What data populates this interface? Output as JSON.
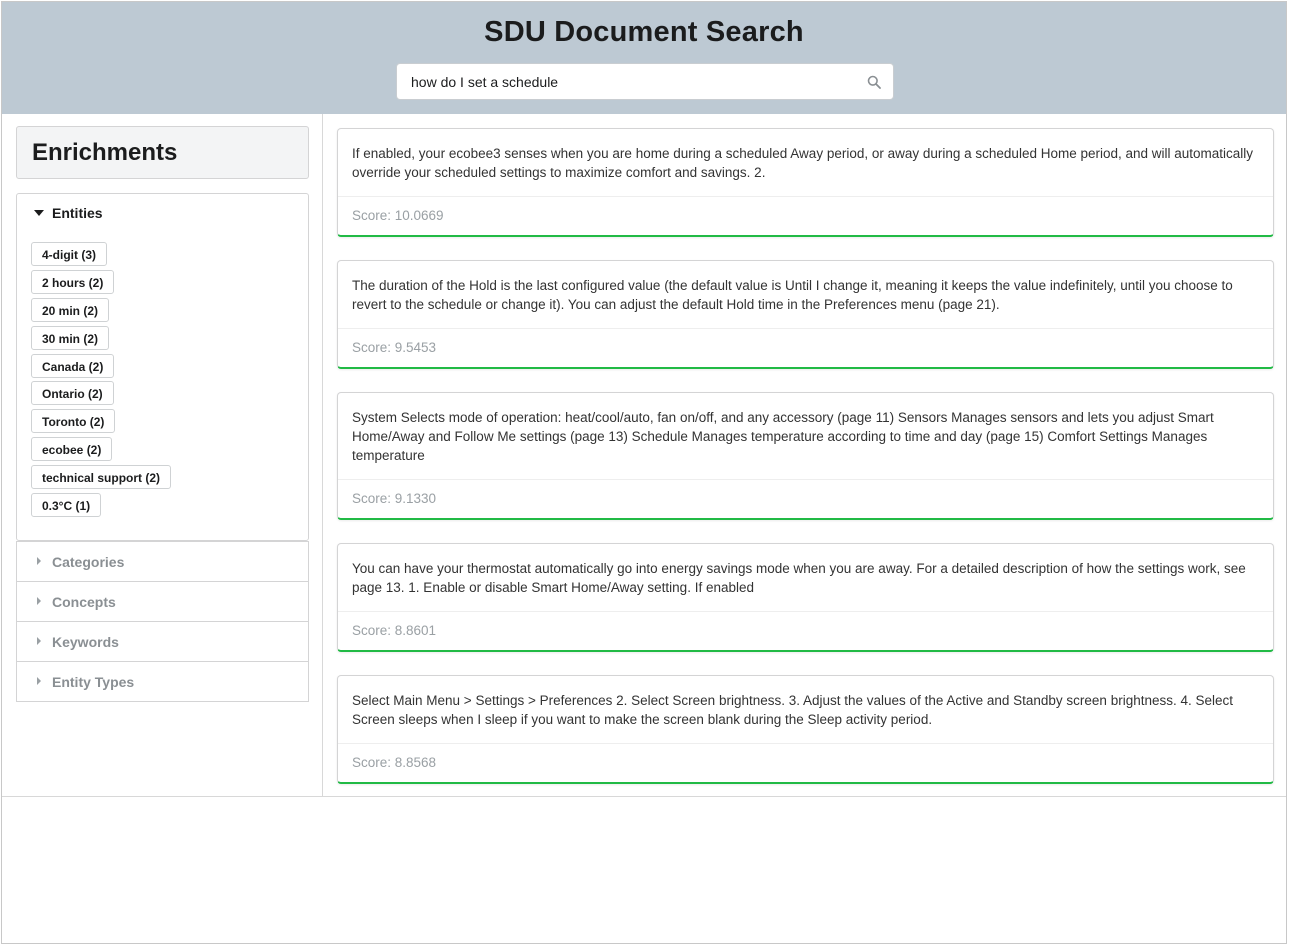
{
  "app": {
    "title": "SDU Document Search"
  },
  "search": {
    "value": "how do I set a schedule",
    "icon": "search-icon"
  },
  "sidebar": {
    "title": "Enrichments",
    "entities": {
      "label": "Entities",
      "expanded": true,
      "items": [
        "4-digit (3)",
        "2 hours (2)",
        "20 min (2)",
        "30 min (2)",
        "Canada (2)",
        "Ontario (2)",
        "Toronto (2)",
        "ecobee (2)",
        "technical support (2)",
        "0.3°C (1)"
      ]
    },
    "collapsed_panels": [
      {
        "label": "Categories"
      },
      {
        "label": "Concepts"
      },
      {
        "label": "Keywords"
      },
      {
        "label": "Entity Types"
      }
    ]
  },
  "results": [
    {
      "text": "If enabled, your ecobee3 senses when you are home during a scheduled Away period, or away during a scheduled Home period, and will automatically override your scheduled settings to maximize comfort and savings. 2.",
      "score": "Score: 10.0669"
    },
    {
      "text": "The duration of the Hold is the last configured value (the default value is Until I change it, meaning it keeps the value indefinitely, until you choose to revert to the schedule or change it). You can adjust the default Hold time in the Preferences menu (page 21).",
      "score": "Score: 9.5453"
    },
    {
      "text": "System Selects mode of operation: heat/cool/auto, fan on/off, and any accessory (page 11) Sensors Manages sensors and lets you adjust Smart Home/Away and Follow Me settings (page 13) Schedule Manages temperature according to time and day (page 15) Comfort Settings Manages temperature",
      "score": "Score: 9.1330"
    },
    {
      "text": "You can have your thermostat automatically go into energy savings mode when you are away. For a detailed description of how the settings work, see page 13. 1. Enable or disable Smart Home/Away setting. If enabled",
      "score": "Score: 8.8601"
    },
    {
      "text": "Select Main Menu > Settings > Preferences 2. Select Screen brightness. 3. Adjust the values of the Active and Standby screen brightness. 4. Select Screen sleeps when I sleep if you want to make the screen blank during the Sleep activity period.",
      "score": "Score: 8.8568"
    }
  ],
  "colors": {
    "header_bg": "#bdc9d3",
    "card_accent": "#21ba45",
    "muted_text": "#9aa0a4"
  }
}
